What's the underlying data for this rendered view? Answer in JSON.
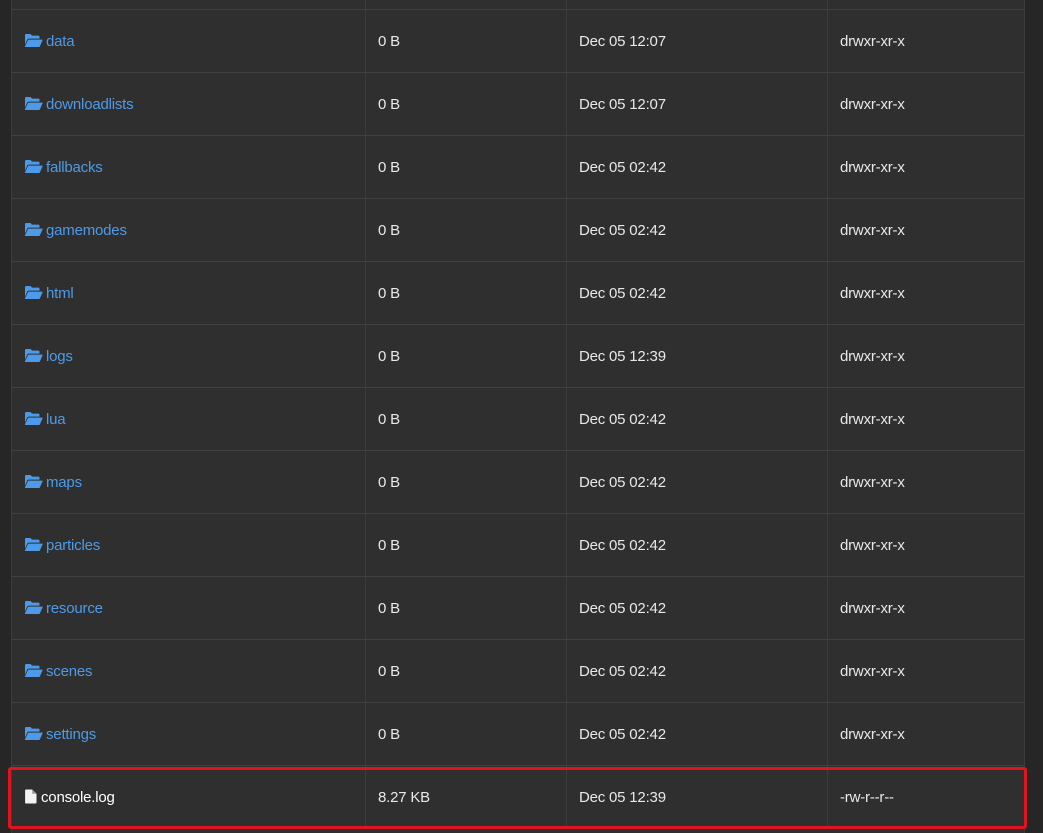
{
  "files": [
    {
      "name": "data",
      "size": "0 B",
      "modified": "Dec 05 12:07",
      "perms": "drwxr-xr-x",
      "type": "folder"
    },
    {
      "name": "downloadlists",
      "size": "0 B",
      "modified": "Dec 05 12:07",
      "perms": "drwxr-xr-x",
      "type": "folder"
    },
    {
      "name": "fallbacks",
      "size": "0 B",
      "modified": "Dec 05 02:42",
      "perms": "drwxr-xr-x",
      "type": "folder"
    },
    {
      "name": "gamemodes",
      "size": "0 B",
      "modified": "Dec 05 02:42",
      "perms": "drwxr-xr-x",
      "type": "folder"
    },
    {
      "name": "html",
      "size": "0 B",
      "modified": "Dec 05 02:42",
      "perms": "drwxr-xr-x",
      "type": "folder"
    },
    {
      "name": "logs",
      "size": "0 B",
      "modified": "Dec 05 12:39",
      "perms": "drwxr-xr-x",
      "type": "folder"
    },
    {
      "name": "lua",
      "size": "0 B",
      "modified": "Dec 05 02:42",
      "perms": "drwxr-xr-x",
      "type": "folder"
    },
    {
      "name": "maps",
      "size": "0 B",
      "modified": "Dec 05 02:42",
      "perms": "drwxr-xr-x",
      "type": "folder"
    },
    {
      "name": "particles",
      "size": "0 B",
      "modified": "Dec 05 02:42",
      "perms": "drwxr-xr-x",
      "type": "folder"
    },
    {
      "name": "resource",
      "size": "0 B",
      "modified": "Dec 05 02:42",
      "perms": "drwxr-xr-x",
      "type": "folder"
    },
    {
      "name": "scenes",
      "size": "0 B",
      "modified": "Dec 05 02:42",
      "perms": "drwxr-xr-x",
      "type": "folder"
    },
    {
      "name": "settings",
      "size": "0 B",
      "modified": "Dec 05 02:42",
      "perms": "drwxr-xr-x",
      "type": "folder"
    },
    {
      "name": "console.log",
      "size": "8.27 KB",
      "modified": "Dec 05 12:39",
      "perms": "-rw-r--r--",
      "type": "file",
      "highlighted": true
    }
  ],
  "icons": {
    "folder": "folder-open-icon",
    "file": "file-icon"
  },
  "colors": {
    "link": "#4d9be8",
    "highlight": "#e0141e",
    "background": "#2f2f2f",
    "text": "#e8e8e8"
  }
}
